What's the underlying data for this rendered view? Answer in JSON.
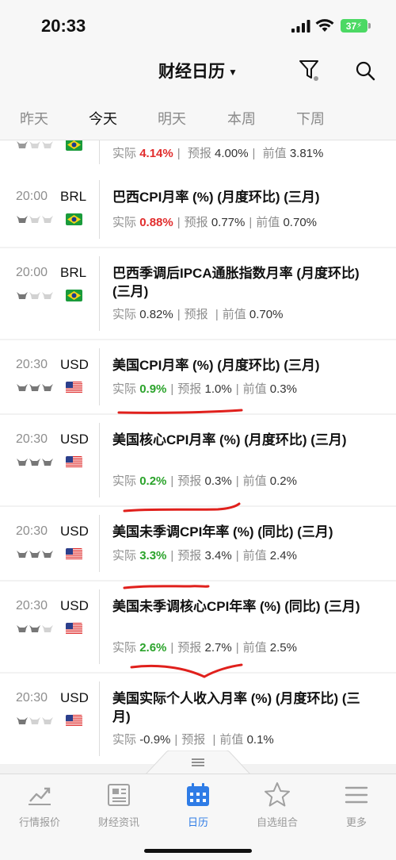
{
  "status": {
    "time": "20:33",
    "battery": "37"
  },
  "header": {
    "title": "财经日历"
  },
  "tabs": [
    "昨天",
    "今天",
    "明天",
    "本周",
    "下周"
  ],
  "active_tab": "今天",
  "labels": {
    "actual": "实际",
    "forecast": "预报",
    "previous": "前值",
    "sep": "|"
  },
  "partial_row": {
    "actual": "4.14%",
    "forecast": "4.00%",
    "previous": "3.81%"
  },
  "events": [
    {
      "time": "20:00",
      "currency": "BRL",
      "flag": "brazil",
      "importance": 1,
      "title": "巴西CPI月率 (%) (月度环比) (三月)",
      "actual": "0.88%",
      "actual_color": "red",
      "forecast": "0.77%",
      "previous": "0.70%"
    },
    {
      "time": "20:00",
      "currency": "BRL",
      "flag": "brazil",
      "importance": 1,
      "title": "巴西季调后IPCA通胀指数月率 (月度环比) (三月)",
      "actual": "0.82%",
      "actual_color": "normal",
      "forecast": "",
      "previous": "0.70%"
    },
    {
      "time": "20:30",
      "currency": "USD",
      "flag": "usa",
      "importance": 3,
      "title": "美国CPI月率 (%) (月度环比) (三月)",
      "actual": "0.9%",
      "actual_color": "green",
      "forecast": "1.0%",
      "previous": "0.3%"
    },
    {
      "time": "20:30",
      "currency": "USD",
      "flag": "usa",
      "importance": 3,
      "title": "美国核心CPI月率 (%) (月度环比) (三月)",
      "actual": "0.2%",
      "actual_color": "green",
      "forecast": "0.3%",
      "previous": "0.2%"
    },
    {
      "time": "20:30",
      "currency": "USD",
      "flag": "usa",
      "importance": 3,
      "title": "美国未季调CPI年率 (%) (同比) (三月)",
      "actual": "3.3%",
      "actual_color": "green",
      "forecast": "3.4%",
      "previous": "2.4%"
    },
    {
      "time": "20:30",
      "currency": "USD",
      "flag": "usa",
      "importance": 2,
      "title": "美国未季调核心CPI年率 (%) (同比) (三月)",
      "actual": "2.6%",
      "actual_color": "green",
      "forecast": "2.7%",
      "previous": "2.5%"
    },
    {
      "time": "20:30",
      "currency": "USD",
      "flag": "usa",
      "importance": 1,
      "title": "美国实际个人收入月率 (%) (月度环比) (三月)",
      "actual": "-0.9%",
      "actual_color": "normal",
      "forecast": "",
      "previous": "0.1%"
    }
  ],
  "bottom_nav": [
    {
      "label": "行情报价",
      "icon": "chart-icon"
    },
    {
      "label": "财经资讯",
      "icon": "news-icon"
    },
    {
      "label": "日历",
      "icon": "calendar-icon"
    },
    {
      "label": "自选组合",
      "icon": "star-icon"
    },
    {
      "label": "更多",
      "icon": "menu-icon"
    }
  ],
  "active_nav": "日历",
  "colors": {
    "accent": "#2f7ce6",
    "red": "#e12d2d",
    "green": "#2ba32b",
    "ink": "#e0201c"
  }
}
